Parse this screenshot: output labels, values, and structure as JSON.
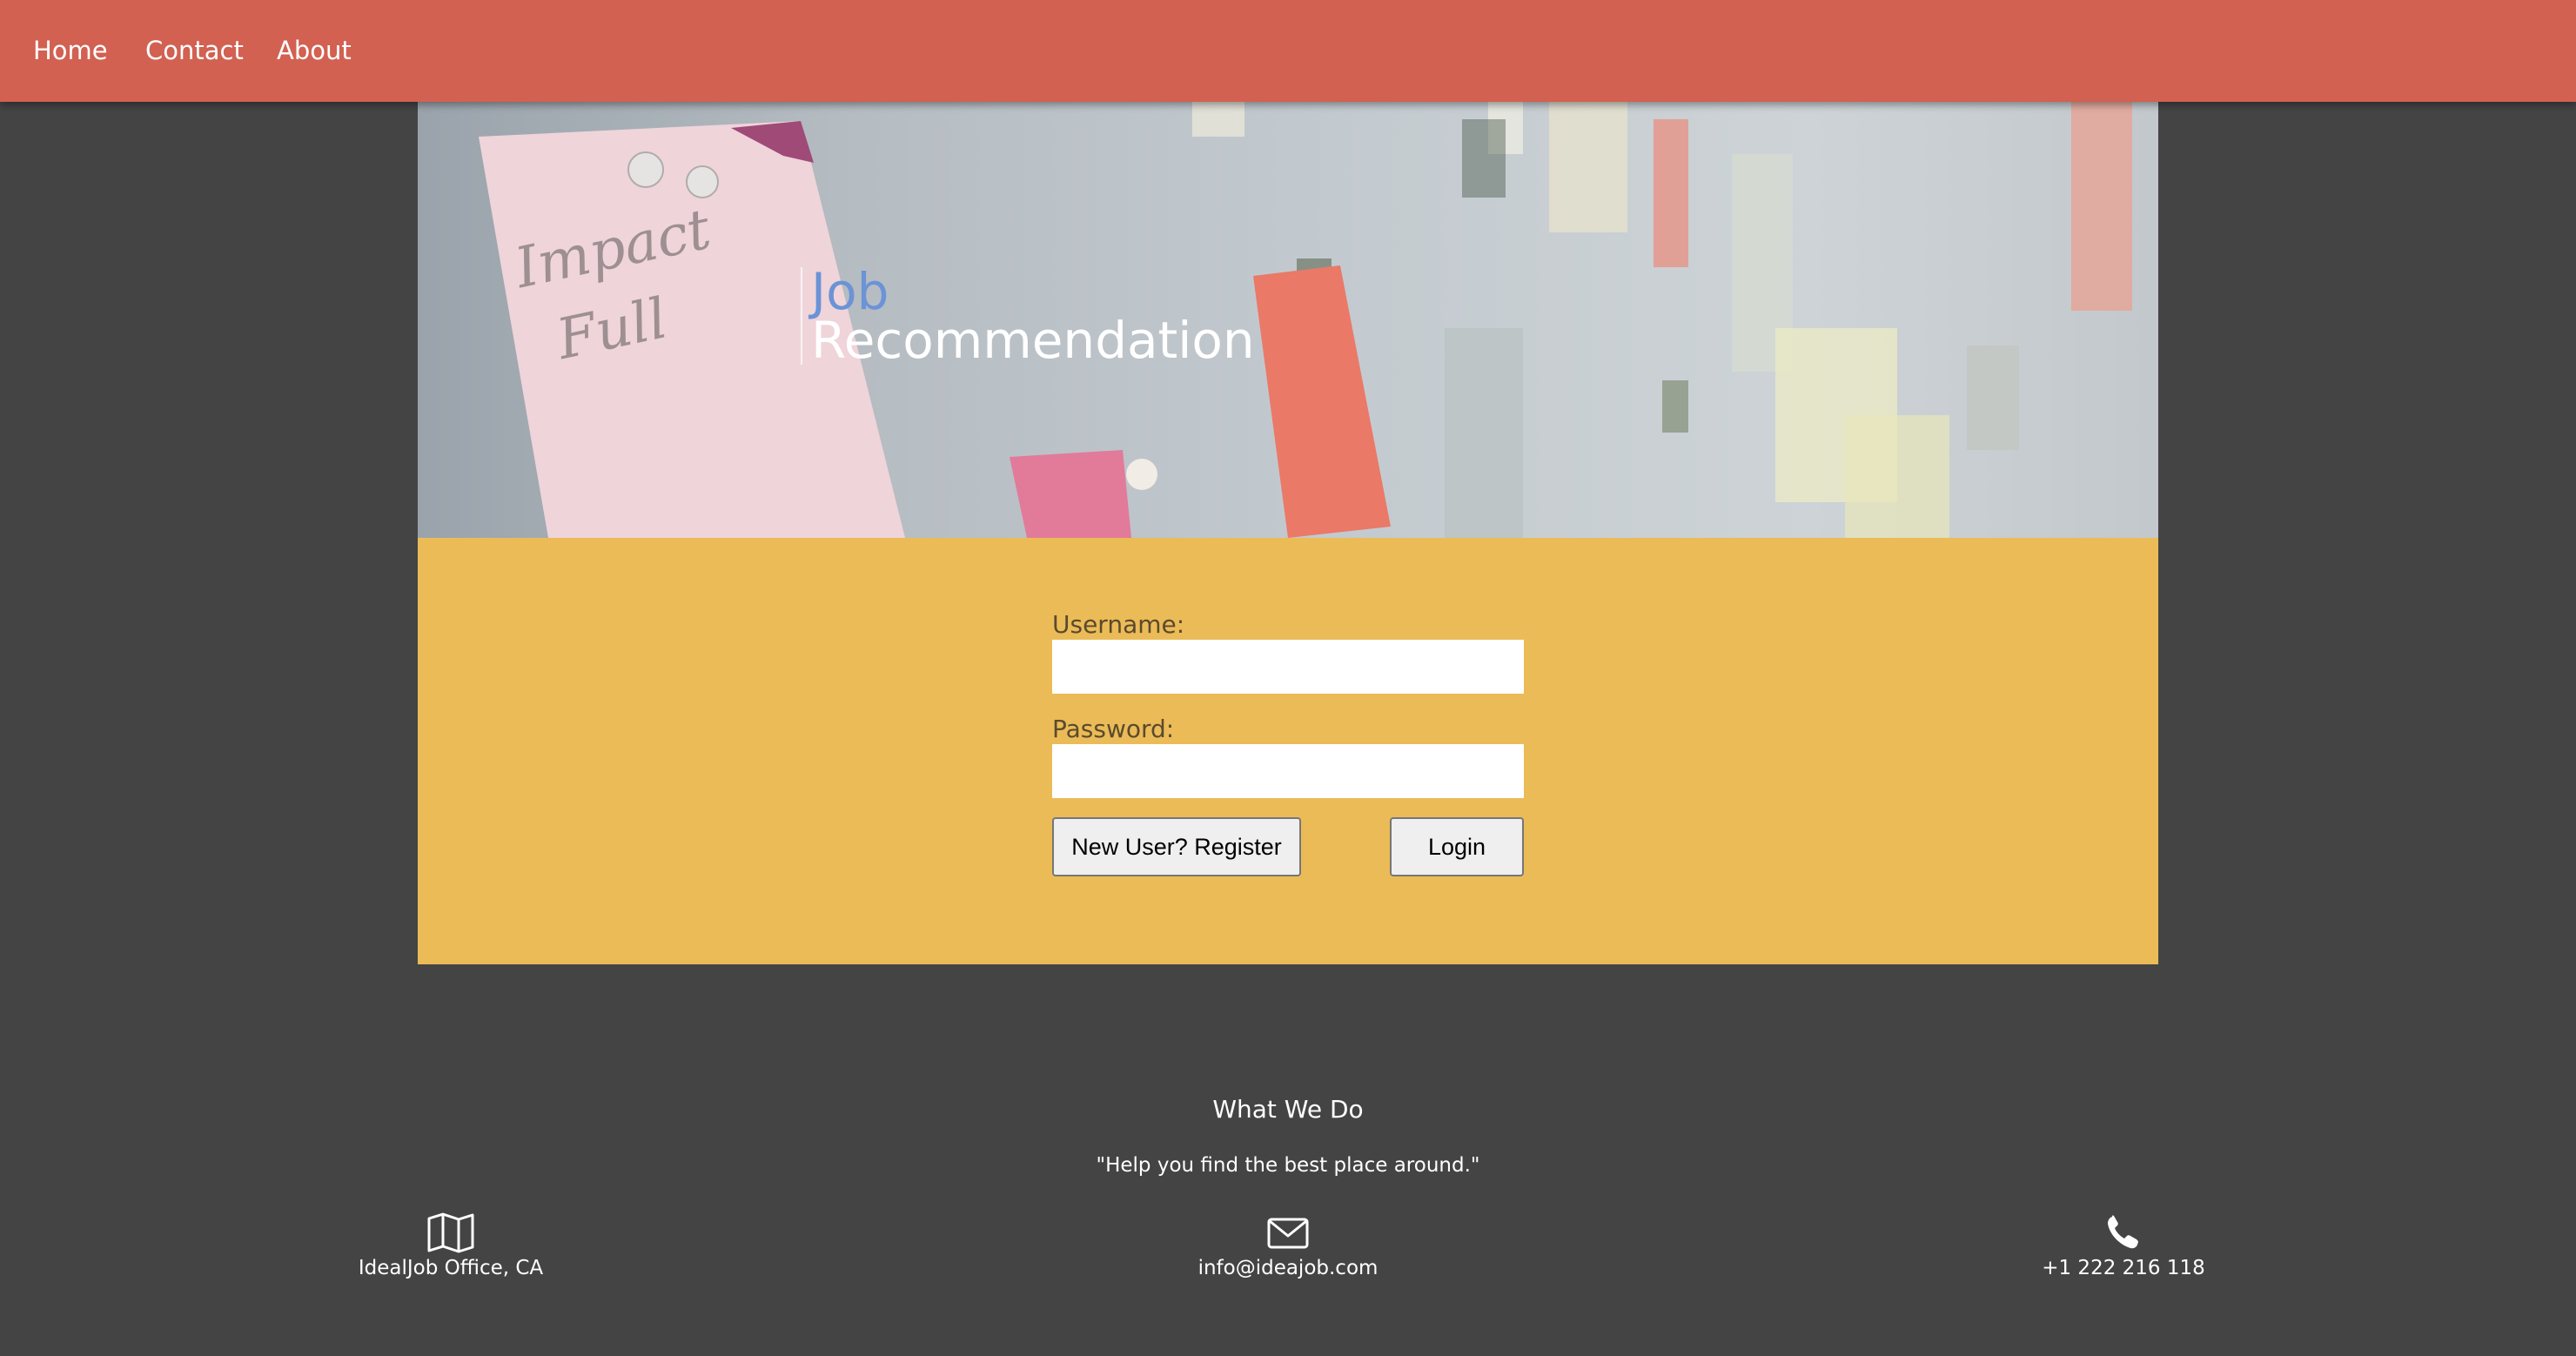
{
  "nav": {
    "items": [
      {
        "label": "Home"
      },
      {
        "label": "Contact"
      },
      {
        "label": "About"
      }
    ]
  },
  "hero": {
    "title_line1": "Job",
    "title_line2": "Recommendation",
    "note_text_1": "Impact",
    "note_text_2": "Full"
  },
  "login": {
    "username_label": "Username:",
    "username_value": "",
    "password_label": "Password:",
    "password_value": "",
    "register_label": "New User? Register",
    "login_label": "Login"
  },
  "footer": {
    "heading": "What We Do",
    "quote": "\"Help you find the best place around.\"",
    "contacts": [
      {
        "icon": "map-icon",
        "text": "IdealJob Office, CA"
      },
      {
        "icon": "envelope-icon",
        "text": "info@ideajob.com"
      },
      {
        "icon": "phone-icon",
        "text": "+1 222 216 118"
      }
    ]
  },
  "colors": {
    "nav_bg": "#d26152",
    "page_bg": "#444444",
    "panel_bg": "#ebbb57",
    "title_accent": "#6b93d6"
  }
}
